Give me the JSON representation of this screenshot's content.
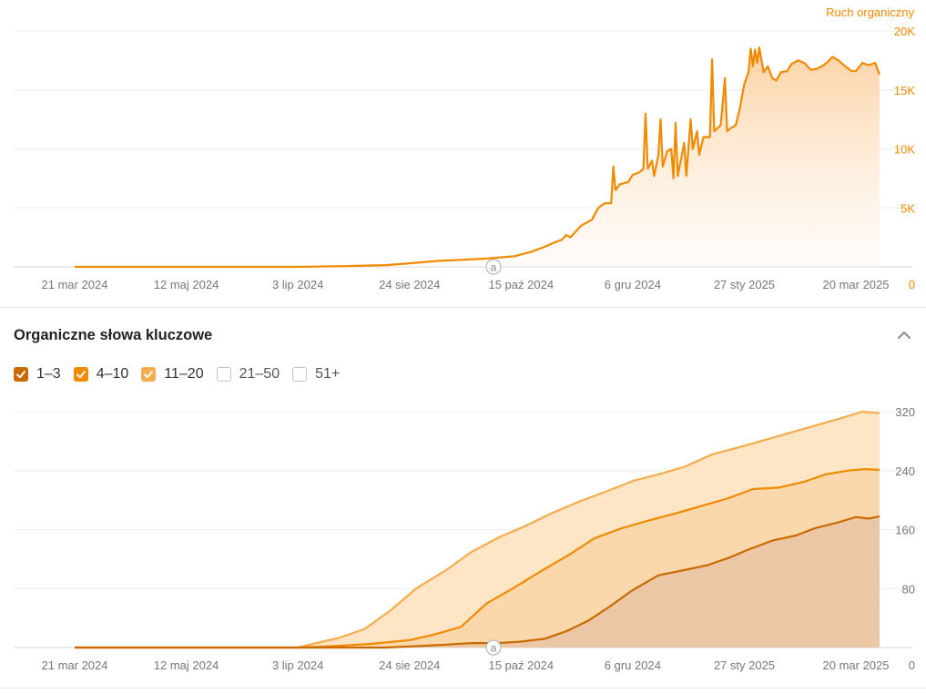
{
  "traffic": {
    "legend": "Ruch organiczny",
    "color": "#f08a00",
    "chart_data": {
      "type": "area",
      "title": "",
      "series_name": "Ruch organiczny",
      "ylim": [
        0,
        20000
      ],
      "y_ticks": [
        0,
        5000,
        10000,
        15000,
        20000
      ],
      "y_tick_labels": [
        "0",
        "5K",
        "10K",
        "15K",
        "20K"
      ],
      "x_tick_labels": [
        "21 mar 2024",
        "12 maj 2024",
        "3 lip 2024",
        "24 sie 2024",
        "15 paź 2024",
        "6 gru 2024",
        "27 sty 2025",
        "20 mar 2025"
      ],
      "x_tick_dates": [
        "2024-03-21",
        "2024-05-12",
        "2024-07-03",
        "2024-08-24",
        "2024-10-15",
        "2024-12-06",
        "2025-01-27",
        "2025-03-20"
      ],
      "points": [
        [
          "2024-03-21",
          0
        ],
        [
          "2024-05-12",
          0
        ],
        [
          "2024-07-03",
          0
        ],
        [
          "2024-07-25",
          60
        ],
        [
          "2024-08-13",
          150
        ],
        [
          "2024-08-24",
          300
        ],
        [
          "2024-09-06",
          500
        ],
        [
          "2024-09-18",
          600
        ],
        [
          "2024-09-29",
          700
        ],
        [
          "2024-10-12",
          900
        ],
        [
          "2024-10-20",
          1300
        ],
        [
          "2024-10-26",
          1700
        ],
        [
          "2024-10-31",
          2100
        ],
        [
          "2024-11-03",
          2300
        ],
        [
          "2024-11-05",
          2700
        ],
        [
          "2024-11-07",
          2500
        ],
        [
          "2024-11-12",
          3500
        ],
        [
          "2024-11-17",
          4000
        ],
        [
          "2024-11-20",
          5000
        ],
        [
          "2024-11-23",
          5400
        ],
        [
          "2024-11-26",
          5400
        ],
        [
          "2024-11-27",
          8500
        ],
        [
          "2024-11-28",
          6500
        ],
        [
          "2024-11-30",
          7000
        ],
        [
          "2024-12-04",
          7200
        ],
        [
          "2024-12-06",
          7800
        ],
        [
          "2024-12-09",
          8000
        ],
        [
          "2024-12-11",
          8300
        ],
        [
          "2024-12-12",
          13000
        ],
        [
          "2024-12-13",
          8300
        ],
        [
          "2024-12-15",
          9000
        ],
        [
          "2024-12-16",
          7700
        ],
        [
          "2024-12-18",
          9500
        ],
        [
          "2024-12-19",
          12500
        ],
        [
          "2024-12-20",
          8500
        ],
        [
          "2024-12-22",
          9800
        ],
        [
          "2024-12-24",
          10000
        ],
        [
          "2024-12-25",
          7500
        ],
        [
          "2024-12-26",
          12200
        ],
        [
          "2024-12-27",
          7700
        ],
        [
          "2024-12-30",
          10500
        ],
        [
          "2024-12-31",
          7700
        ],
        [
          "2025-01-02",
          12500
        ],
        [
          "2025-01-03",
          10000
        ],
        [
          "2025-01-05",
          11500
        ],
        [
          "2025-01-06",
          9500
        ],
        [
          "2025-01-08",
          11000
        ],
        [
          "2025-01-11",
          11000
        ],
        [
          "2025-01-12",
          17600
        ],
        [
          "2025-01-13",
          11500
        ],
        [
          "2025-01-16",
          12000
        ],
        [
          "2025-01-18",
          16000
        ],
        [
          "2025-01-19",
          11500
        ],
        [
          "2025-01-21",
          11800
        ],
        [
          "2025-01-23",
          12000
        ],
        [
          "2025-01-25",
          13500
        ],
        [
          "2025-01-27",
          15500
        ],
        [
          "2025-01-29",
          16500
        ],
        [
          "2025-01-30",
          18500
        ],
        [
          "2025-01-31",
          17000
        ],
        [
          "2025-02-01",
          18400
        ],
        [
          "2025-02-02",
          17300
        ],
        [
          "2025-02-03",
          18600
        ],
        [
          "2025-02-05",
          16500
        ],
        [
          "2025-02-07",
          17000
        ],
        [
          "2025-02-09",
          16000
        ],
        [
          "2025-02-11",
          15800
        ],
        [
          "2025-02-13",
          16500
        ],
        [
          "2025-02-16",
          16600
        ],
        [
          "2025-02-18",
          17200
        ],
        [
          "2025-02-21",
          17500
        ],
        [
          "2025-02-24",
          17300
        ],
        [
          "2025-02-27",
          16700
        ],
        [
          "2025-03-02",
          16800
        ],
        [
          "2025-03-05",
          17100
        ],
        [
          "2025-03-07",
          17400
        ],
        [
          "2025-03-09",
          17800
        ],
        [
          "2025-03-12",
          17500
        ],
        [
          "2025-03-15",
          17000
        ],
        [
          "2025-03-18",
          16600
        ],
        [
          "2025-03-20",
          16600
        ],
        [
          "2025-03-23",
          17300
        ],
        [
          "2025-03-26",
          17100
        ],
        [
          "2025-03-29",
          17300
        ],
        [
          "2025-03-31",
          16300
        ]
      ]
    }
  },
  "keywords": {
    "title": "Organiczne słowa kluczowe",
    "filters": [
      {
        "label": "1–3",
        "checked": true,
        "color": "#c96a00"
      },
      {
        "label": "4–10",
        "checked": true,
        "color": "#f08a00"
      },
      {
        "label": "11–20",
        "checked": true,
        "color": "#f5ac4c"
      },
      {
        "label": "21–50",
        "checked": false,
        "color": "#ffffff"
      },
      {
        "label": "51+",
        "checked": false,
        "color": "#ffffff"
      }
    ],
    "chart_data": {
      "type": "area",
      "title": "",
      "ylim": [
        0,
        320
      ],
      "y_ticks": [
        0,
        80,
        160,
        240,
        320
      ],
      "y_tick_labels": [
        "0",
        "80",
        "160",
        "240",
        "320"
      ],
      "x_tick_labels": [
        "21 mar 2024",
        "12 maj 2024",
        "3 lip 2024",
        "24 sie 2024",
        "15 paź 2024",
        "6 gru 2024",
        "27 sty 2025",
        "20 mar 2025"
      ],
      "x_tick_dates": [
        "2024-03-21",
        "2024-05-12",
        "2024-07-03",
        "2024-08-24",
        "2024-10-15",
        "2024-12-06",
        "2025-01-27",
        "2025-03-20"
      ],
      "series": [
        {
          "label": "1–3",
          "color": "#c96a00",
          "fill": "#ecc7a6",
          "points": [
            [
              "2024-03-21",
              0
            ],
            [
              "2024-07-03",
              0
            ],
            [
              "2024-08-13",
              0
            ],
            [
              "2024-08-28",
              2
            ],
            [
              "2024-09-10",
              4
            ],
            [
              "2024-09-22",
              6
            ],
            [
              "2024-10-04",
              6
            ],
            [
              "2024-10-15",
              8
            ],
            [
              "2024-10-26",
              12
            ],
            [
              "2024-11-05",
              22
            ],
            [
              "2024-11-15",
              36
            ],
            [
              "2024-11-25",
              55
            ],
            [
              "2024-12-06",
              78
            ],
            [
              "2024-12-18",
              98
            ],
            [
              "2024-12-30",
              105
            ],
            [
              "2025-01-10",
              112
            ],
            [
              "2025-01-20",
              122
            ],
            [
              "2025-01-29",
              133
            ],
            [
              "2025-02-09",
              145
            ],
            [
              "2025-02-20",
              152
            ],
            [
              "2025-03-01",
              162
            ],
            [
              "2025-03-12",
              170
            ],
            [
              "2025-03-20",
              177
            ],
            [
              "2025-03-26",
              175
            ],
            [
              "2025-03-31",
              178
            ]
          ]
        },
        {
          "label": "4–10",
          "color": "#f08a00",
          "fill": "#fbd8ab",
          "points": [
            [
              "2024-03-21",
              0
            ],
            [
              "2024-07-03",
              0
            ],
            [
              "2024-07-20",
              2
            ],
            [
              "2024-08-06",
              5
            ],
            [
              "2024-08-24",
              10
            ],
            [
              "2024-09-05",
              18
            ],
            [
              "2024-09-17",
              28
            ],
            [
              "2024-09-29",
              60
            ],
            [
              "2024-10-11",
              80
            ],
            [
              "2024-10-25",
              105
            ],
            [
              "2024-11-06",
              125
            ],
            [
              "2024-11-18",
              148
            ],
            [
              "2024-12-01",
              162
            ],
            [
              "2024-12-13",
              172
            ],
            [
              "2024-12-26",
              182
            ],
            [
              "2025-01-07",
              192
            ],
            [
              "2025-01-19",
              202
            ],
            [
              "2025-01-31",
              215
            ],
            [
              "2025-02-12",
              217
            ],
            [
              "2025-02-24",
              225
            ],
            [
              "2025-03-06",
              235
            ],
            [
              "2025-03-16",
              240
            ],
            [
              "2025-03-24",
              242
            ],
            [
              "2025-03-31",
              241
            ]
          ]
        },
        {
          "label": "11–20",
          "color": "#f5ac4c",
          "fill": "#fde5c6",
          "points": [
            [
              "2024-03-21",
              0
            ],
            [
              "2024-07-03",
              0
            ],
            [
              "2024-07-10",
              5
            ],
            [
              "2024-07-22",
              13
            ],
            [
              "2024-08-03",
              25
            ],
            [
              "2024-08-15",
              50
            ],
            [
              "2024-08-27",
              80
            ],
            [
              "2024-09-10",
              105
            ],
            [
              "2024-09-22",
              130
            ],
            [
              "2024-10-05",
              150
            ],
            [
              "2024-10-17",
              165
            ],
            [
              "2024-10-29",
              182
            ],
            [
              "2024-11-11",
              198
            ],
            [
              "2024-11-24",
              212
            ],
            [
              "2024-12-06",
              226
            ],
            [
              "2024-12-18",
              235
            ],
            [
              "2024-12-30",
              245
            ],
            [
              "2025-01-12",
              262
            ],
            [
              "2025-01-25",
              272
            ],
            [
              "2025-02-06",
              282
            ],
            [
              "2025-02-18",
              292
            ],
            [
              "2025-03-02",
              302
            ],
            [
              "2025-03-14",
              312
            ],
            [
              "2025-03-23",
              320
            ],
            [
              "2025-03-31",
              318
            ]
          ]
        }
      ]
    }
  }
}
